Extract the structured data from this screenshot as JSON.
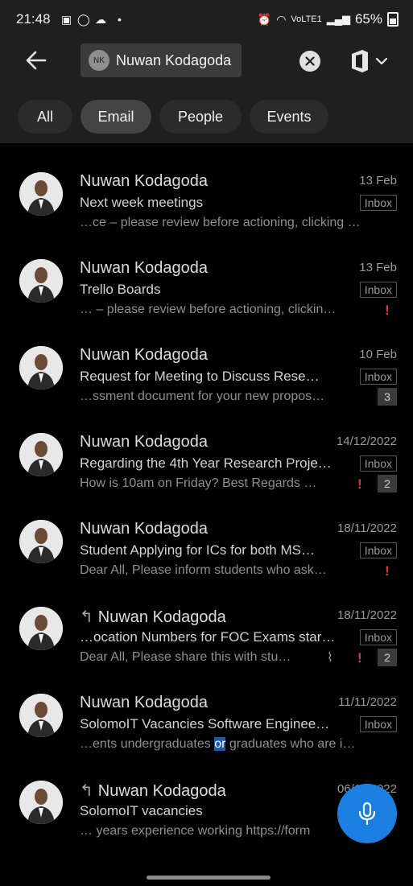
{
  "status": {
    "time": "21:48",
    "battery": "65%",
    "net": "VoLTE1"
  },
  "search": {
    "chip_initials": "NK",
    "chip_name": "Nuwan Kodagoda"
  },
  "filters": [
    "All",
    "Email",
    "People",
    "Events"
  ],
  "emails": [
    {
      "sender": "Nuwan Kodagoda",
      "date": "13 Feb",
      "subject": "Next week meetings",
      "folder": "Inbox",
      "preview": "…ce – please review before actioning, clicking …",
      "flag": false,
      "count": "",
      "reply": false,
      "attachment": false
    },
    {
      "sender": "Nuwan Kodagoda",
      "date": "13 Feb",
      "subject": "Trello Boards",
      "folder": "Inbox",
      "preview": "… – please review before actioning, clickin…",
      "flag": true,
      "count": "",
      "reply": false,
      "attachment": false
    },
    {
      "sender": "Nuwan Kodagoda",
      "date": "10 Feb",
      "subject": "Request for Meeting to Discuss Rese…",
      "folder": "Inbox",
      "preview": "…ssment document for your new propos…",
      "flag": false,
      "count": "3",
      "reply": false,
      "attachment": false
    },
    {
      "sender": "Nuwan Kodagoda",
      "date": "14/12/2022",
      "subject": "Regarding the 4th Year Research Proje…",
      "folder": "Inbox",
      "preview": "How is 10am on Friday? Best Regards …",
      "flag": true,
      "count": "2",
      "reply": false,
      "attachment": false
    },
    {
      "sender": "Nuwan Kodagoda",
      "date": "18/11/2022",
      "subject": "Student Applying for ICs for both MS…",
      "folder": "Inbox",
      "preview": "Dear All, Please inform students who ask…",
      "flag": true,
      "count": "",
      "reply": false,
      "attachment": false
    },
    {
      "sender": "Nuwan Kodagoda",
      "date": "18/11/2022",
      "subject": "…ocation Numbers for FOC Exams star…",
      "folder": "Inbox",
      "preview": "Dear All, Please share this with stu…",
      "flag": true,
      "count": "2",
      "reply": true,
      "attachment": true
    },
    {
      "sender": "Nuwan Kodagoda",
      "date": "11/11/2022",
      "subject": "SolomoIT Vacancies Software Enginee…",
      "folder": "Inbox",
      "preview_before": "…ents undergraduates ",
      "preview_highlight": "or",
      "preview_after": " graduates who are i…",
      "flag": false,
      "count": "",
      "reply": false,
      "attachment": false
    },
    {
      "sender": "Nuwan Kodagoda",
      "date": "06/11/2022",
      "subject": "SolomoIT vacancies",
      "folder": "",
      "preview": "… years experience working https://form",
      "flag": false,
      "count": "",
      "reply": true,
      "attachment": false
    }
  ],
  "icons": {
    "back": "arrow-left-icon",
    "clear": "close-circle-icon",
    "account": "office-icon",
    "mic": "microphone-icon"
  }
}
